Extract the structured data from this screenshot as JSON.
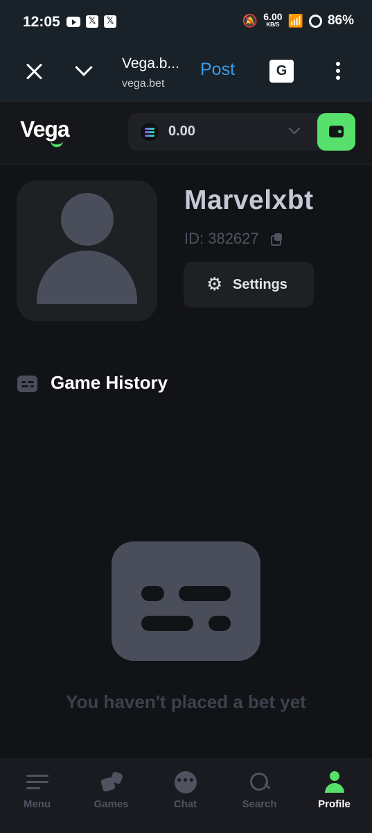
{
  "status_bar": {
    "time": "12:05",
    "net_speed": "6.00",
    "net_unit": "KB/S",
    "battery": "86%"
  },
  "browser": {
    "page_title": "Vega.b...",
    "url": "vega.bet",
    "post_label": "Post",
    "translate_icon": "translate-icon"
  },
  "header": {
    "logo": "Vega",
    "balance": "0.00",
    "currency_icon": "solana-icon",
    "accent_color": "#57e06b"
  },
  "profile": {
    "username": "Marvelxbt",
    "id_label": "ID: 382627",
    "settings_label": "Settings"
  },
  "game_history": {
    "title": "Game History",
    "empty_message": "You haven't placed a bet yet"
  },
  "bottom_nav": {
    "items": [
      {
        "label": "Menu",
        "icon": "menu-icon"
      },
      {
        "label": "Games",
        "icon": "dice-icon"
      },
      {
        "label": "Chat",
        "icon": "chat-icon"
      },
      {
        "label": "Search",
        "icon": "search-icon"
      },
      {
        "label": "Profile",
        "icon": "profile-icon"
      }
    ],
    "active": "Profile"
  }
}
